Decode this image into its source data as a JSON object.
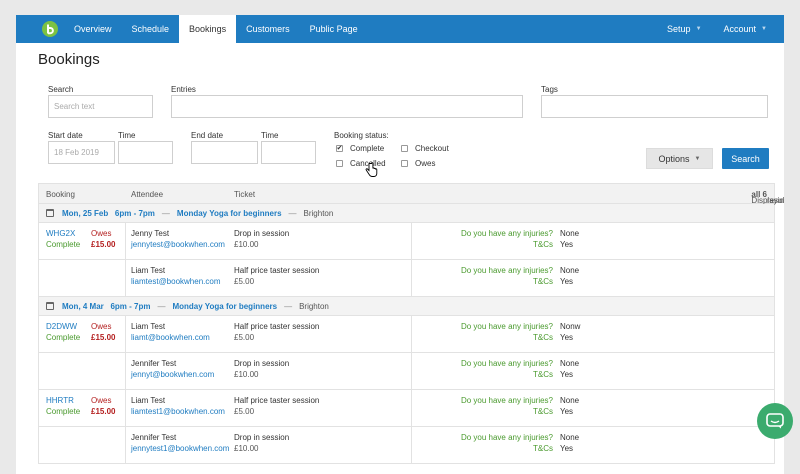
{
  "nav": {
    "items": [
      "Overview",
      "Schedule",
      "Bookings",
      "Customers",
      "Public Page"
    ],
    "active": "Bookings",
    "right": [
      "Setup",
      "Account"
    ]
  },
  "page": {
    "title": "Bookings"
  },
  "filters": {
    "search_label": "Search",
    "search_placeholder": "Search text",
    "entries_label": "Entries",
    "tags_label": "Tags",
    "start_date_label": "Start date",
    "start_date_value": "18 Feb 2019",
    "time_label": "Time",
    "end_date_label": "End date",
    "end_time_label": "Time",
    "status_label": "Booking status:",
    "status_options": [
      {
        "label": "Complete",
        "checked": true
      },
      {
        "label": "Cancelled",
        "checked": false
      },
      {
        "label": "Checkout",
        "checked": false
      },
      {
        "label": "Owes",
        "checked": false
      }
    ],
    "options_button": "Options",
    "search_button": "Search"
  },
  "table": {
    "headers": {
      "booking": "Booking",
      "attendee": "Attendee",
      "ticket": "Ticket"
    },
    "results_prefix": "Displaying",
    "results_strong": "all 6",
    "results_suffix": "results",
    "sessions": [
      {
        "date": "Mon, 25 Feb   6pm - 7pm",
        "name": "Monday Yoga for beginners",
        "location": "Brighton",
        "rows": [
          {
            "ref": "WHG2X",
            "status": "Complete",
            "owes_label": "Owes",
            "owes": "£15.00",
            "name": "Jenny Test",
            "email": "jennytest@bookwhen.com",
            "ticket": "Drop in session",
            "price": "£10.00",
            "q1": "Do you have any injuries?",
            "a1": "None",
            "q2": "T&Cs",
            "a2": "Yes"
          },
          {
            "ref": "",
            "status": "",
            "owes_label": "",
            "owes": "",
            "name": "Liam Test",
            "email": "liamtest@bookwhen.com",
            "ticket": "Half price taster session",
            "price": "£5.00",
            "q1": "Do you have any injuries?",
            "a1": "None",
            "q2": "T&Cs",
            "a2": "Yes"
          }
        ]
      },
      {
        "date": "Mon, 4 Mar   6pm - 7pm",
        "name": "Monday Yoga for beginners",
        "location": "Brighton",
        "rows": [
          {
            "ref": "D2DWW",
            "status": "Complete",
            "owes_label": "Owes",
            "owes": "£15.00",
            "name": "Liam Test",
            "email": "liamt@bookwhen.com",
            "ticket": "Half price taster session",
            "price": "£5.00",
            "q1": "Do you have any injuries?",
            "a1": "Nonw",
            "q2": "T&Cs",
            "a2": "Yes"
          },
          {
            "ref": "",
            "status": "",
            "owes_label": "",
            "owes": "",
            "name": "Jennifer Test",
            "email": "jennyt@bookwhen.com",
            "ticket": "Drop in session",
            "price": "£10.00",
            "q1": "Do you have any injuries?",
            "a1": "None",
            "q2": "T&Cs",
            "a2": "Yes"
          },
          {
            "ref": "HHRTR",
            "status": "Complete",
            "owes_label": "Owes",
            "owes": "£15.00",
            "name": "Liam Test",
            "email": "liamtest1@bookwhen.com",
            "ticket": "Half price taster session",
            "price": "£5.00",
            "q1": "Do you have any injuries?",
            "a1": "None",
            "q2": "T&Cs",
            "a2": "Yes"
          },
          {
            "ref": "",
            "status": "",
            "owes_label": "",
            "owes": "",
            "name": "Jennifer Test",
            "email": "jennytest1@bookwhen.com",
            "ticket": "Drop in session",
            "price": "£10.00",
            "q1": "Do you have any injuries?",
            "a1": "None",
            "q2": "T&Cs",
            "a2": "Yes"
          }
        ]
      }
    ]
  },
  "colors": {
    "brand": "#1f7cc1",
    "success": "#4a9a2e",
    "danger": "#b42020",
    "chat": "#3bab6e"
  },
  "icons": [
    "bookwhen-logo-icon",
    "calendar-icon",
    "checkbox-icon",
    "hand-cursor-icon",
    "chat-icon",
    "chevron-down-icon"
  ]
}
